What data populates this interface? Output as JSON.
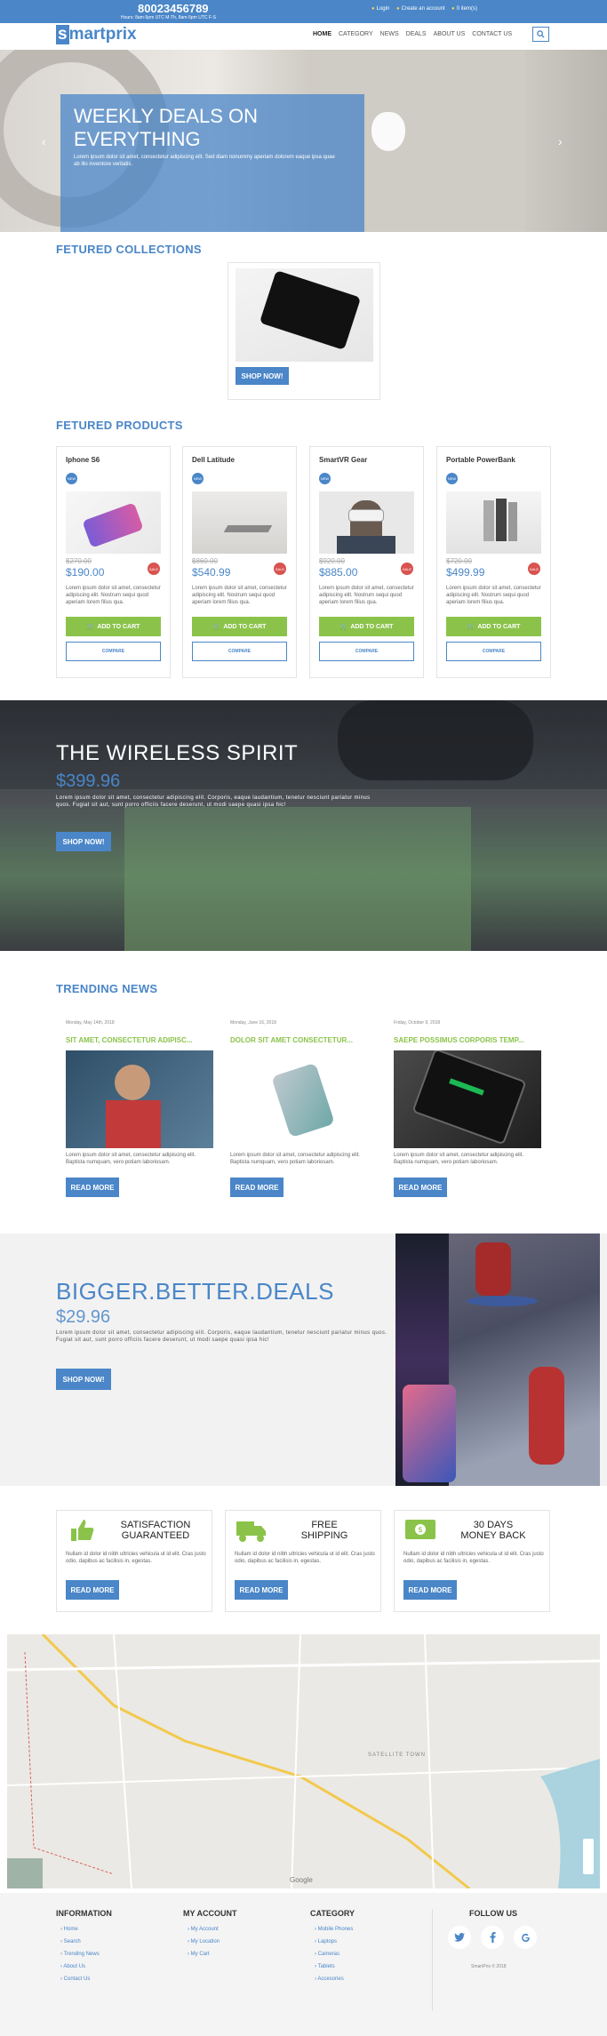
{
  "colors": {
    "primary": "#4a86c8",
    "accent": "#8bc34a",
    "sale": "#d9534f"
  },
  "topbar": {
    "phone": "80023456789",
    "hours": "Hours: 8am-5pm UTC M-Th, 8am-5pm UTC F-S",
    "login": "Login",
    "create_account": "Create an account",
    "cart": "0 item(s)"
  },
  "header": {
    "logo_s": "s",
    "logo_rest": "martprix",
    "nav": [
      "HOME",
      "CATEGORY",
      "NEWS",
      "DEALS",
      "ABOUT US",
      "CONTACT US"
    ]
  },
  "hero": {
    "title": "WEEKLY DEALS ON EVERYTHING",
    "text": "Lorem ipsum dolor sit amet, consectetur adipiscing elit. Sed diam nonummy aperiam dolorem eaque ipsa quae ab illo inventore veritatis."
  },
  "featured_collections": {
    "title": "FETURED COLLECTIONS",
    "button": "SHOP NOW!"
  },
  "featured_products": {
    "title": "FETURED PRODUCTS",
    "new_badge": "NEW",
    "sale_badge": "SALE",
    "desc": "Lorem ipsum dolor sit amet, consectetur adipiscing elit. Nostrum sequi quod aperiam lorem filius qua.",
    "add_to_cart": "ADD TO CART",
    "compare": "COMPARE",
    "items": [
      {
        "name": "Iphone S6",
        "old_price": "$270.00",
        "price": "$190.00"
      },
      {
        "name": "Dell Latitude",
        "old_price": "$860.00",
        "price": "$540.99"
      },
      {
        "name": "SmartVR Gear",
        "old_price": "$920.00",
        "price": "$885.00"
      },
      {
        "name": "Portable PowerBank",
        "old_price": "$720.00",
        "price": "$499.99"
      }
    ]
  },
  "wireless": {
    "title": "THE WIRELESS SPIRIT",
    "price": "$399.96",
    "text": "Lorem ipsum dolor sit amet, consectetur adipiscing elit. Corporis, eaque laudantium, tenetur nesciunt pariatur minus quos. Fugiat sit aut, sunt porro officiis facere deserunt, ut modi saepe quasi ipsa hic!",
    "button": "SHOP NOW!"
  },
  "trending": {
    "title": "TRENDING NEWS",
    "read_more": "READ MORE",
    "text": "Lorem ipsum dolor sit amet, consectetur adipiscing elit. Baptista numquam, vero potiam laboriosam.",
    "items": [
      {
        "date": "Monday, May 14th, 2018",
        "heading": "SIT AMET, CONSECTETUR ADIPISC..."
      },
      {
        "date": "Monday, June 16, 2018",
        "heading": "DOLOR SIT AMET CONSECTETUR..."
      },
      {
        "date": "Friday, October 9, 2018",
        "heading": "SAEPE POSSIMUS CORPORIS TEMP..."
      }
    ]
  },
  "bigger": {
    "title": "BIGGER.BETTER.DEALS",
    "price": "$29.96",
    "text": "Lorem ipsum dolor sit amet, consectetur adipiscing elit. Corporis, eaque laudantium, tenetur nesciunt pariatur minus quos. Fugiat sit aut, sunt porro officiis facere deserunt, ut modi saepe quasi ipsa hic!",
    "button": "SHOP NOW!"
  },
  "features": {
    "read_more": "READ MORE",
    "text": "Nullam id dolor id nibh ultricies vehicula ut id elit. Cras justo odio, dapibus ac facilisis in, egestas.",
    "items": [
      {
        "line1": "SATISFACTION",
        "line2": "GUARANTEED",
        "icon": "thumbs-up-icon"
      },
      {
        "line1": "FREE",
        "line2": "SHIPPING",
        "icon": "truck-icon"
      },
      {
        "line1": "30 DAYS",
        "line2": "MONEY BACK",
        "icon": "money-icon"
      }
    ]
  },
  "map": {
    "label": "SATELLITE TOWN",
    "google": "Google"
  },
  "footer": {
    "information": {
      "title": "INFORMATION",
      "links": [
        "Home",
        "Search",
        "Trending News",
        "About Us",
        "Contact Us"
      ]
    },
    "account": {
      "title": "MY ACCOUNT",
      "links": [
        "My Account",
        "My Location",
        "My Cart"
      ]
    },
    "category": {
      "title": "CATEGORY",
      "links": [
        "Mobile Phones",
        "Laptops",
        "Cameras",
        "Tablets",
        "Accesories"
      ]
    },
    "follow": {
      "title": "FOLLOW US",
      "copyright": "SmartPrix © 2018"
    }
  }
}
